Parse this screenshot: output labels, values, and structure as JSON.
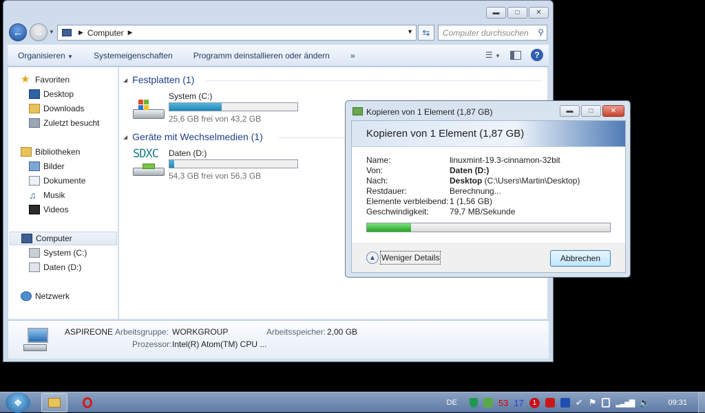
{
  "explorer": {
    "address": {
      "path": "Computer"
    },
    "search": {
      "placeholder": "Computer durchsuchen"
    },
    "toolbar": {
      "organize": "Organisieren",
      "sysprops": "Systemeigenschaften",
      "uninstall": "Programm deinstallieren oder ändern",
      "more": "»"
    },
    "nav": {
      "favorites": "Favoriten",
      "desktop": "Desktop",
      "downloads": "Downloads",
      "recent": "Zuletzt besucht",
      "libraries": "Bibliotheken",
      "pictures": "Bilder",
      "documents": "Dokumente",
      "music": "Musik",
      "videos": "Videos",
      "computer": "Computer",
      "drive_c": "System (C:)",
      "drive_d": "Daten (D:)",
      "network": "Netzwerk"
    },
    "groups": {
      "hdd": "Festplatten (1)",
      "removable": "Geräte mit Wechselmedien (1)"
    },
    "drives": [
      {
        "name": "System (C:)",
        "free_text": "25,6 GB frei von 43,2 GB",
        "used_fraction": 0.41
      },
      {
        "name": "Daten (D:)",
        "free_text": "54,3 GB frei von 56,3 GB",
        "used_fraction": 0.04,
        "icon_text": "SDXC"
      }
    ],
    "details": {
      "name": "ASPIREONE",
      "workgroup_label": "Arbeitsgruppe:",
      "workgroup": "WORKGROUP",
      "memory_label": "Arbeitsspeicher:",
      "memory": "2,00 GB",
      "cpu_label": "Prozessor:",
      "cpu": "Intel(R) Atom(TM) CPU ..."
    }
  },
  "copy_dialog": {
    "title": "Kopieren von 1 Element (1,87 GB)",
    "heading": "Kopieren von 1 Element (1,87 GB)",
    "rows": [
      {
        "key": "Name:",
        "value": "linuxmint-19.3-cinnamon-32bit"
      },
      {
        "key": "Von:",
        "value_bold": "Daten (D:)",
        "value": ""
      },
      {
        "key": "Nach:",
        "value_bold": "Desktop",
        "value": " (C:\\Users\\Martin\\Desktop)"
      },
      {
        "key": "Restdauer:",
        "value": "Berechnung..."
      },
      {
        "key": "Elemente verbleibend:",
        "value": "1 (1,56 GB)"
      },
      {
        "key": "Geschwindigkeit:",
        "value": "79,7 MB/Sekunde"
      }
    ],
    "progress_fraction": 0.18,
    "less_details": "Weniger Details",
    "cancel": "Abbrechen"
  },
  "taskbar": {
    "lang": "DE",
    "tray_numbers": [
      "53",
      "17",
      "1"
    ],
    "clock": "09:31"
  }
}
